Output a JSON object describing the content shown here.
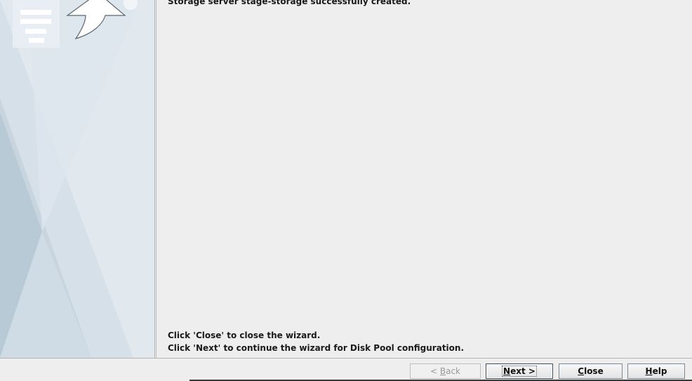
{
  "messages": {
    "top": "Storage server stage-storage successfully created.",
    "close_hint": "Click 'Close' to close the wizard.",
    "next_hint": "Click 'Next' to continue the wizard for Disk Pool configuration."
  },
  "buttons": {
    "back": {
      "prefix": "< ",
      "mnemonic": "B",
      "rest": "ack",
      "enabled": false
    },
    "next": {
      "mnemonic": "N",
      "rest": "ext >",
      "enabled": true
    },
    "close": {
      "mnemonic": "C",
      "rest": "lose",
      "enabled": true
    },
    "help": {
      "mnemonic": "H",
      "rest": "elp",
      "enabled": true
    }
  },
  "icons": {
    "wizard_graphic": "server-stack-arrow-icon"
  },
  "colors": {
    "sidebar_bg": "#d6e0e8",
    "content_bg": "#eeeeee"
  }
}
